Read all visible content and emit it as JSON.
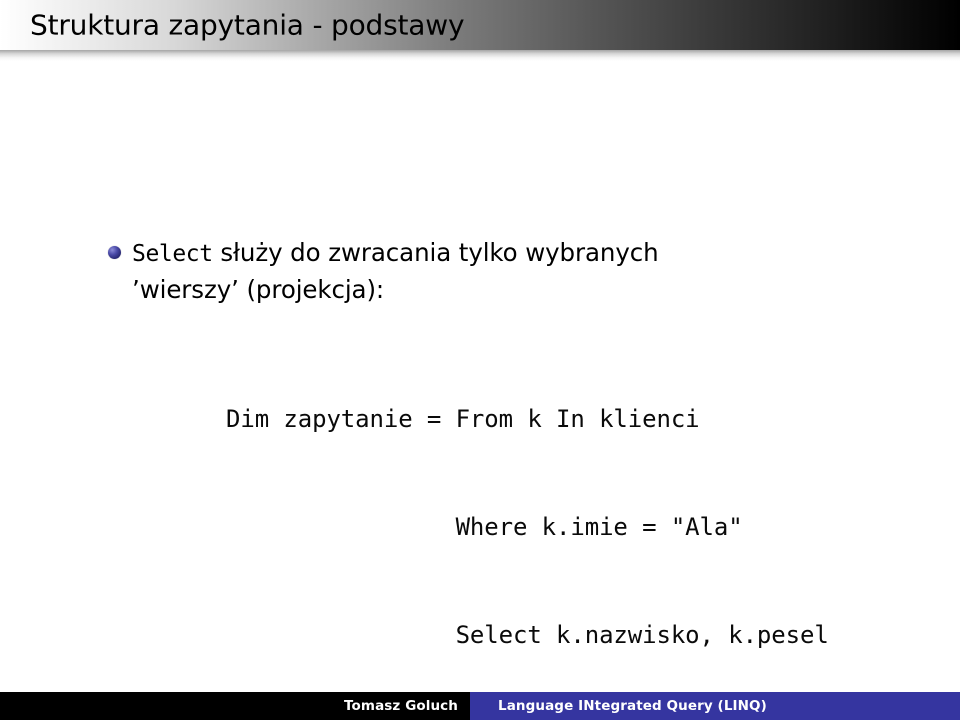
{
  "slide": {
    "title": "Struktura zapytania - podstawy",
    "bullets": [
      {
        "keyword": "Select",
        "text": " służy do zwracania tylko wybranych ’wierszy’ (projekcja):"
      }
    ],
    "code": {
      "language": "vb-linq",
      "lines": [
        "Dim zapytanie = From k In klienci",
        "                Where k.imie = \"Ala\"",
        "                Select k.nazwisko, k.pesel"
      ]
    }
  },
  "footer": {
    "author": "Tomasz Goluch",
    "presentation_title": "Language INtegrated Query (LINQ)",
    "author_bg": "#000000",
    "title_bg": "#3535a0",
    "text_color": "#ffffff"
  },
  "theme": {
    "bullet_color": "#2b2b78",
    "header_gradient_from": "#ffffff",
    "header_gradient_to": "#000000",
    "title_color": "#000000",
    "body_bg": "#ffffff"
  }
}
